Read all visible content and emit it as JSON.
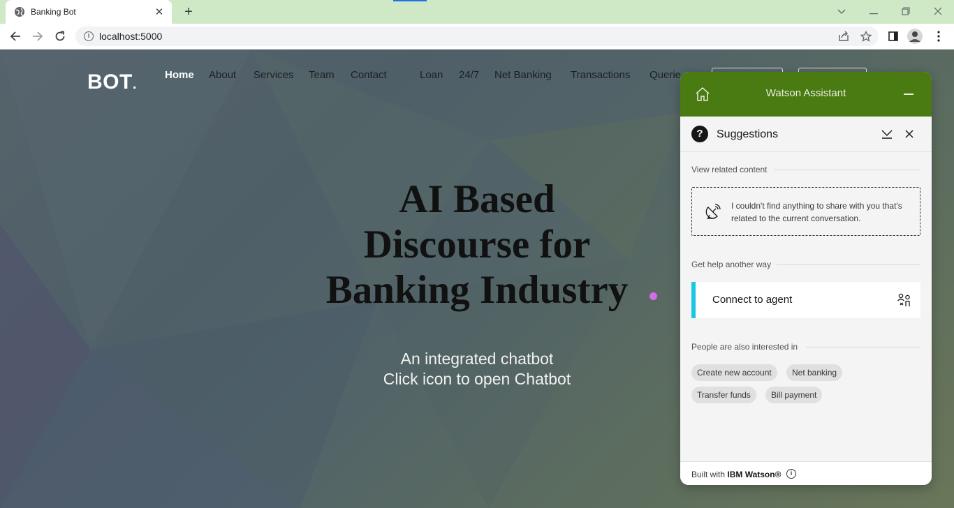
{
  "browser": {
    "tab_title": "Banking Bot",
    "url": "localhost:5000",
    "new_tab": "+",
    "tab_close": "✕"
  },
  "site": {
    "brand": "BOT",
    "brand_dot": ".",
    "nav": [
      "Home",
      "About",
      "Services",
      "Team",
      "Contact",
      "Loan",
      "24/7",
      "Net Banking",
      "Transactions",
      "Querie"
    ],
    "active_nav": "Home",
    "hero_title_lines": [
      "AI Based",
      "Discourse for",
      "Banking Industry"
    ],
    "hero_sub_lines": [
      "An integrated chatbot",
      "Click icon to open Chatbot"
    ],
    "accent_color": "#d36ce6"
  },
  "watson": {
    "title": "Watson Assistant",
    "header_color": "#4a7a12",
    "suggestions_title": "Suggestions",
    "question_mark": "?",
    "related_label": "View related content",
    "no_content_text": "I couldn't find anything to share with you that's related to the current conversation.",
    "help_label": "Get help another way",
    "connect_label": "Connect to agent",
    "interested_label": "People are also interested in",
    "chips": [
      "Create new account",
      "Net banking",
      "Transfer funds",
      "Bill payment"
    ],
    "footer_prefix": "Built with",
    "footer_brand": "IBM Watson®",
    "footer_info_icon": "i"
  }
}
